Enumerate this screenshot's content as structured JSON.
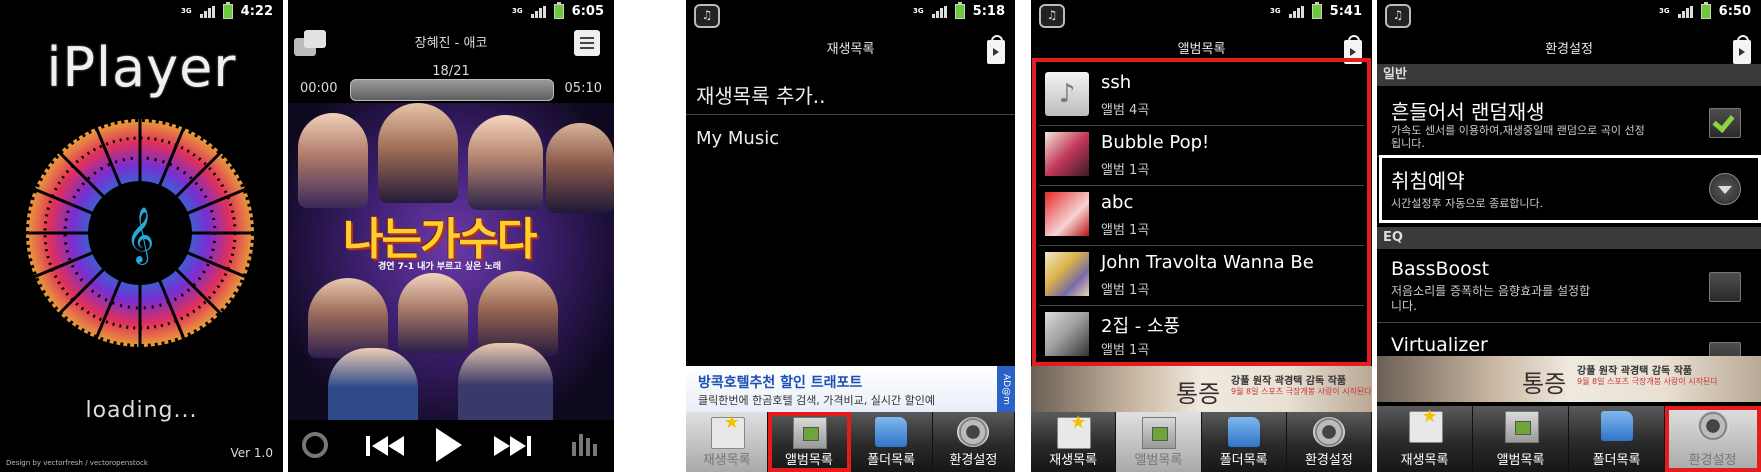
{
  "status_time": {
    "s1": "4:22",
    "s2": "6:05",
    "s3": "5:18",
    "s4": "5:41",
    "s5": "6:50"
  },
  "network_label": "3G",
  "screen1": {
    "app_title": "iPlayer",
    "loading": "loading...",
    "credit": "Design by vectorfresh / vectoropenstock",
    "version": "Ver 1.0"
  },
  "screen2": {
    "song_title": "장혜진 - 애코",
    "track_pos": "18/21",
    "time_elapsed": "00:00",
    "time_total": "05:10",
    "progress": 0.0,
    "album_art_text": "나는가수다",
    "album_art_sub": "경연 7-1 내가 부르고 싶은 노래"
  },
  "screen3": {
    "title": "재생목록",
    "items": [
      "재생목록 추가..",
      "My Music"
    ],
    "ad": {
      "line1": "방콕호텔추천 할인 트래포트",
      "line2": "클릭한번에 한곰호텔 검색, 가격비교, 실시간 할인예",
      "tag": "AD@m"
    }
  },
  "screen4": {
    "title": "앨범목록",
    "albums": [
      {
        "name": "ssh",
        "count": "앨범 4곡"
      },
      {
        "name": "Bubble Pop!",
        "count": "앨범 1곡"
      },
      {
        "name": "abc",
        "count": "앨범 1곡"
      },
      {
        "name": "John Travolta Wanna Be",
        "count": "앨범 1곡"
      },
      {
        "name": "2집 - 소풍",
        "count": "앨범 1곡"
      }
    ]
  },
  "screen5": {
    "title": "환경설정",
    "section_general": "일반",
    "shake": {
      "title": "흔들어서 랜덤재생",
      "desc": "가속도 센서를 이용하여,재생중일때 랜덤으로 곡이 선정됩니다.",
      "checked": true
    },
    "sleep": {
      "title": "취침예약",
      "desc": "시간설정후 자동으로 종료합니다."
    },
    "section_eq": "EQ",
    "bass": {
      "title": "BassBoost",
      "desc": "저음소리를 증폭하는 음향효과를 설정합니다.",
      "checked": false
    },
    "virtualizer": {
      "title": "Virtualizer"
    }
  },
  "movie_banner": {
    "title": "통증",
    "line1": "강풀 원작 곽경택 감독 작품",
    "line2": "9월 8일 스포츠 극장개봉 사랑이 시작된다"
  },
  "nav": {
    "playlist": "재생목록",
    "album": "앨범목록",
    "folder": "폴더목록",
    "settings": "환경설정"
  },
  "colors": {
    "highlight_red": "#e41c1c",
    "checkbox_green": "#8ed23f",
    "section_header": "#3a3a3a"
  }
}
